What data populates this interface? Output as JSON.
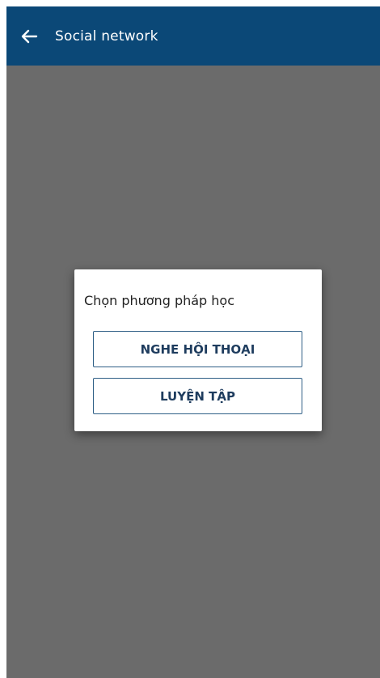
{
  "app_bar": {
    "title": "Social network",
    "back_icon": "arrow-left-icon",
    "background": "#0b4877"
  },
  "overlay": {
    "color": "#6b6b6b"
  },
  "dialog": {
    "title": "Chọn phương pháp học",
    "buttons": [
      {
        "label": "NGHE HỘI THOẠI"
      },
      {
        "label": "LUYỆN TẬP"
      }
    ]
  }
}
